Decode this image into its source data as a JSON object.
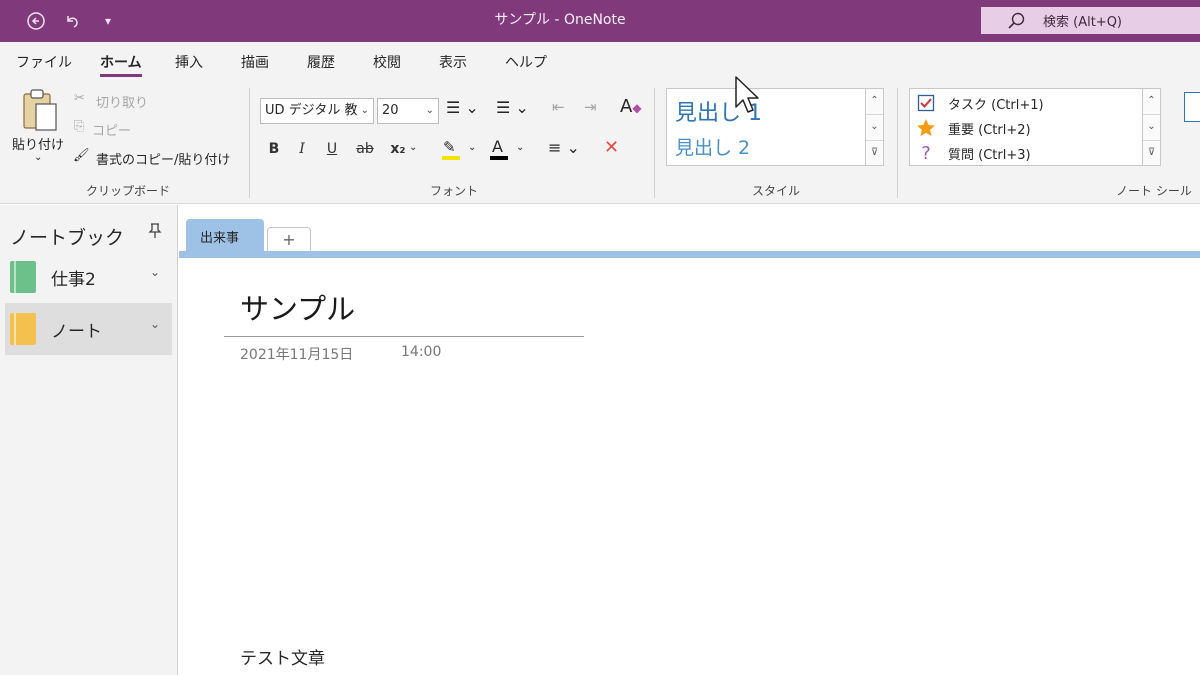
{
  "titlebar": {
    "title": "サンプル  -  OneNote",
    "search_placeholder": "検索 (Alt+Q)",
    "back_icon": "←",
    "undo_icon": "↶",
    "qat_icon": "▾"
  },
  "menu": {
    "tabs": [
      "ファイル",
      "ホーム",
      "挿入",
      "描画",
      "履歴",
      "校閲",
      "表示",
      "ヘルプ"
    ],
    "active": "ホーム"
  },
  "clipboard": {
    "paste": "貼り付け",
    "cut": "切り取り",
    "copy": "コピー",
    "format_painter": "書式のコピー/貼り付け",
    "label": "クリップボード"
  },
  "font": {
    "family": "UD デジタル 教",
    "size": "20",
    "label": "フォント",
    "bold": "B",
    "italic": "I",
    "underline": "U",
    "strike": "ab",
    "subscript": "x₂",
    "font_color": "A",
    "highlight_color": "#f5e400",
    "font_color_value": "#000000"
  },
  "styles": {
    "h1": "見出し 1",
    "h2": "見出し 2",
    "label": "スタイル"
  },
  "tags": {
    "items": [
      {
        "label": "タスク (Ctrl+1)",
        "icon": "checkbox-icon"
      },
      {
        "label": "重要 (Ctrl+2)",
        "icon": "star-icon"
      },
      {
        "label": "質問 (Ctrl+3)",
        "icon": "question-icon"
      }
    ],
    "label": "ノート シール"
  },
  "sidebar": {
    "title": "ノートブック",
    "notebooks": [
      {
        "label": "仕事2",
        "color": "#6cc08a"
      },
      {
        "label": "ノート",
        "color": "#f5c14e"
      }
    ],
    "selected": "ノート"
  },
  "sections": {
    "active": "出来事",
    "add": "+"
  },
  "page": {
    "title": "サンプル",
    "date": "2021年11月15日",
    "time": "14:00",
    "body": "テスト文章"
  },
  "colors": {
    "accent": "#80397b",
    "section": "#9ec1e6",
    "heading": "#2e75b6"
  }
}
